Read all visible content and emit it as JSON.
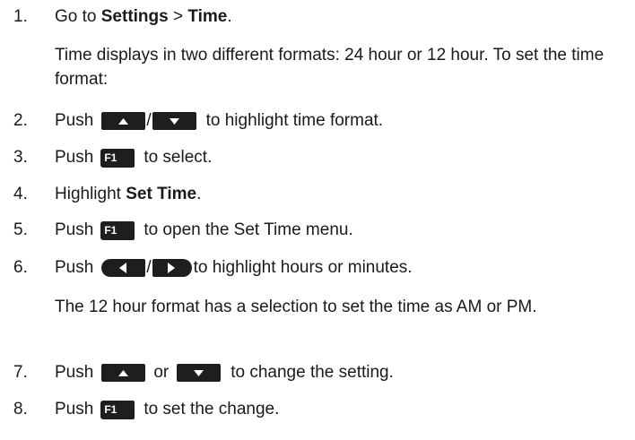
{
  "steps": [
    {
      "num": "1.",
      "before": "Go to ",
      "bold1": "Settings",
      "sep": " > ",
      "bold2": "Time",
      "after": "."
    },
    {
      "num": "2.",
      "push": "Push",
      "slash": "/",
      "after": "to highlight time format."
    },
    {
      "num": "3.",
      "push": "Push",
      "key": "F1",
      "after": "to select."
    },
    {
      "num": "4.",
      "before": "Highlight ",
      "bold": "Set Time",
      "after": "."
    },
    {
      "num": "5.",
      "push": "Push",
      "key": "F1",
      "after": "to open the Set Time menu."
    },
    {
      "num": "6.",
      "push": "Push",
      "slash": "/",
      "after": "to highlight hours or minutes."
    },
    {
      "num": "7.",
      "push": "Push",
      "or": "or",
      "after": "to change the setting."
    },
    {
      "num": "8.",
      "push": "Push",
      "key": "F1",
      "after": "to set the change."
    }
  ],
  "notes": {
    "time_formats": "Time displays in two different formats: 24 hour or 12 hour. To set the time format:",
    "am_pm": "The 12 hour format has a selection to set the time as AM or PM."
  },
  "icons": {
    "up": "up-arrow-key-icon",
    "down": "down-arrow-key-icon",
    "left": "left-arrow-key-icon",
    "right": "right-arrow-key-icon",
    "f1": "f1-key-icon"
  }
}
